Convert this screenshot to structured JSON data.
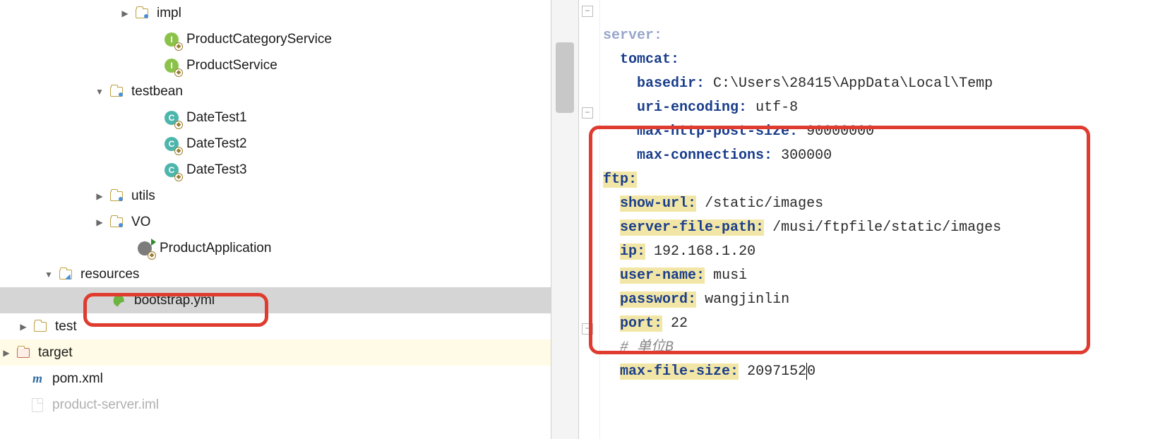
{
  "tree": {
    "impl": "impl",
    "productCategoryService": "ProductCategoryService",
    "productService": "ProductService",
    "testbean": "testbean",
    "dateTest1": "DateTest1",
    "dateTest2": "DateTest2",
    "dateTest3": "DateTest3",
    "utils": "utils",
    "vo": "VO",
    "productApplication": "ProductApplication",
    "resources": "resources",
    "bootstrap": "bootstrap.yml",
    "test": "test",
    "target": "target",
    "pom": "pom.xml",
    "iml": "product-server.iml"
  },
  "code": {
    "server": "server:",
    "tomcat": "tomcat:",
    "basedirKey": "basedir:",
    "basedirVal": "C:\\Users\\28415\\AppData\\Local\\Temp",
    "uriEncKey": "uri-encoding:",
    "uriEncVal": "utf-8",
    "maxHttpKey": "max-http-post-size:",
    "maxHttpVal": "90000000",
    "maxConnKey": "max-connections:",
    "maxConnVal": "300000",
    "ftp": "ftp:",
    "showUrlKey": "show-url:",
    "showUrlVal": "/static/images",
    "serverFilePathKey": "server-file-path:",
    "serverFilePathVal": "/musi/ftpfile/static/images",
    "ipKey": "ip:",
    "ipVal": "192.168.1.20",
    "userNameKey": "user-name:",
    "userNameVal": "musi",
    "passwordKey": "password:",
    "passwordVal": "wangjinlin",
    "portKey": "port:",
    "portVal": "22",
    "comment": "# 单位B",
    "maxFileKey": "max-file-size:",
    "maxFileValA": "2097152",
    "maxFileValB": "0"
  }
}
